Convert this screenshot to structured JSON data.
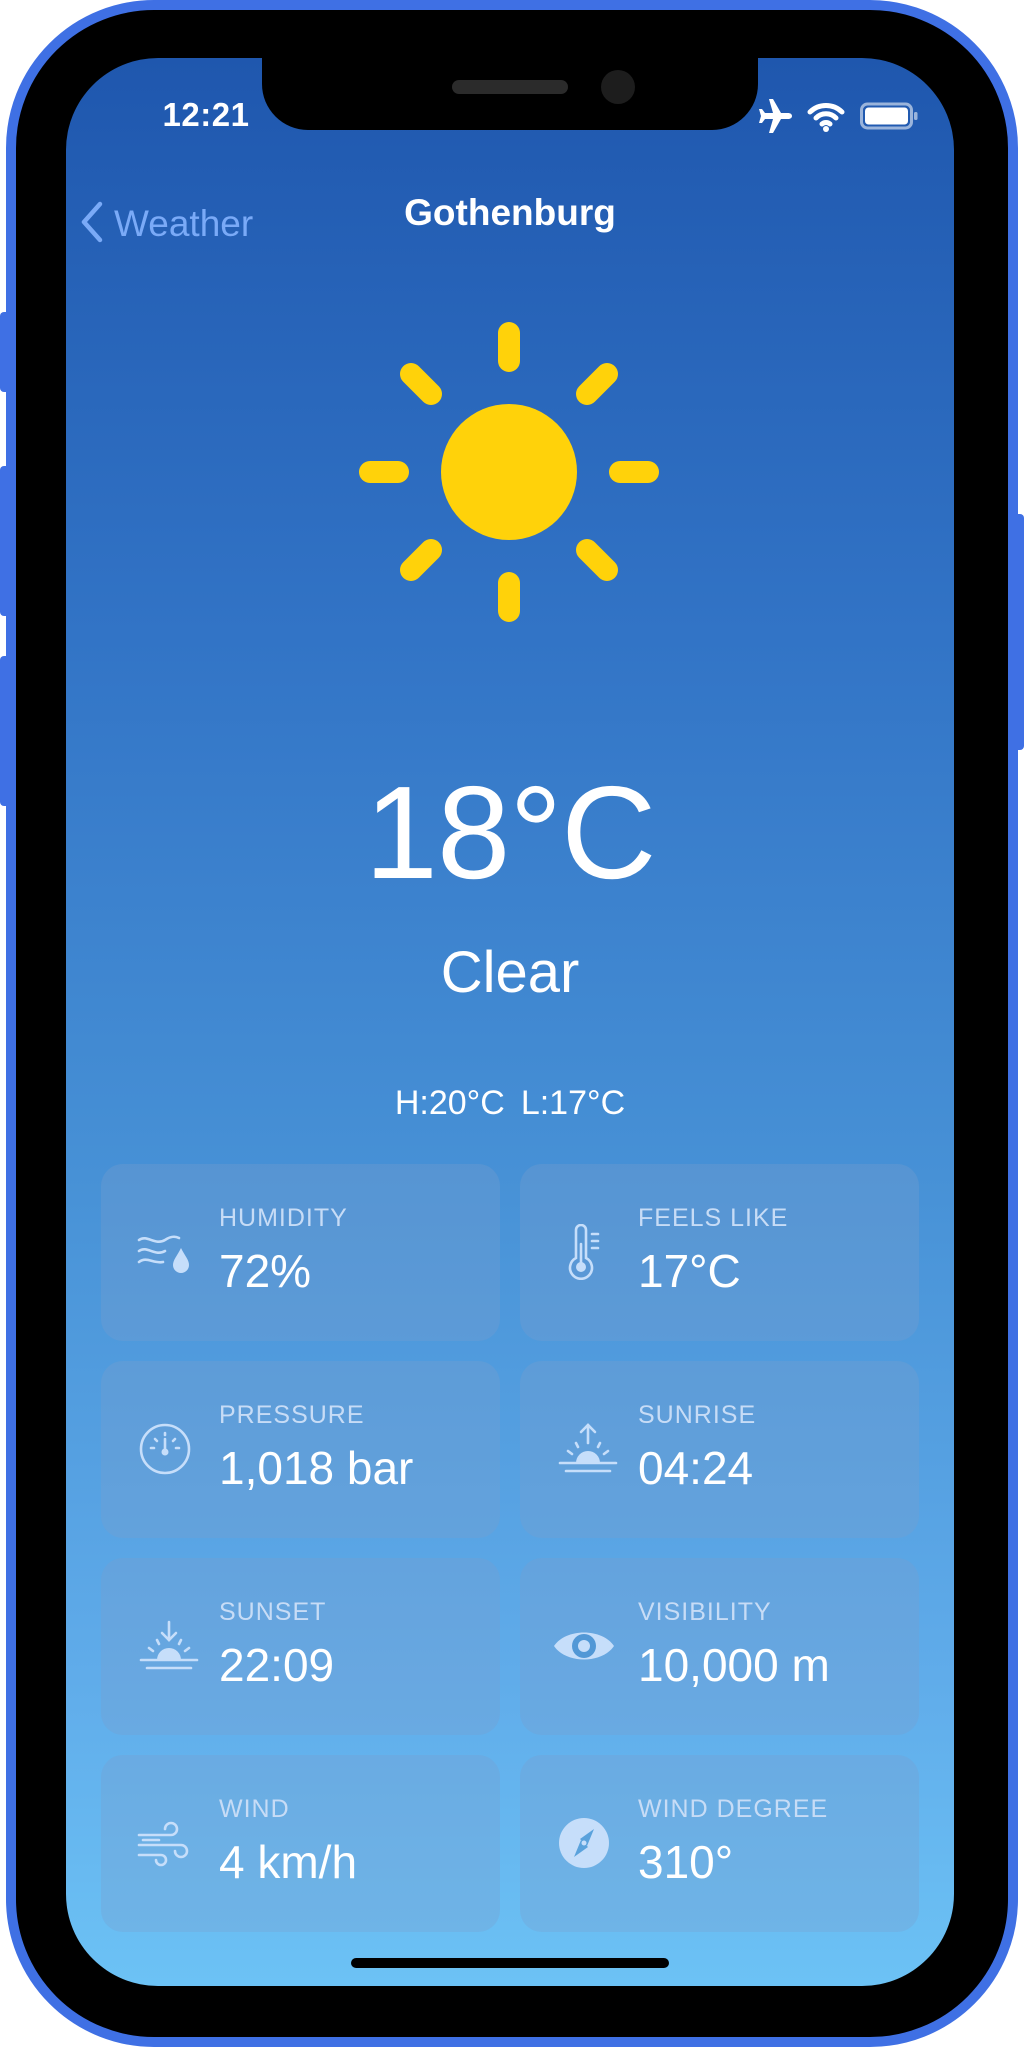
{
  "status_bar": {
    "time": "12:21",
    "icons": [
      "airplane-icon",
      "wifi-icon",
      "battery-icon"
    ]
  },
  "nav": {
    "back_label": "Weather",
    "title": "Gothenburg"
  },
  "current": {
    "icon": "sun-icon",
    "temperature": "18°C",
    "condition": "Clear",
    "high": "H:20°C",
    "low": "L:17°C"
  },
  "cards": [
    {
      "label": "HUMIDITY",
      "value": "72%",
      "icon": "humidity-icon"
    },
    {
      "label": "FEELS LIKE",
      "value": "17°C",
      "icon": "thermometer-icon"
    },
    {
      "label": "PRESSURE",
      "value": "1,018 bar",
      "icon": "gauge-icon"
    },
    {
      "label": "SUNRISE",
      "value": "04:24",
      "icon": "sunrise-icon"
    },
    {
      "label": "SUNSET",
      "value": "22:09",
      "icon": "sunset-icon"
    },
    {
      "label": "VISIBILITY",
      "value": "10,000 m",
      "icon": "eye-icon"
    },
    {
      "label": "WIND",
      "value": "4 km/h",
      "icon": "wind-icon"
    },
    {
      "label": "WIND DEGREE",
      "value": "310°",
      "icon": "compass-icon"
    }
  ],
  "colors": {
    "device_frame": "#3f70e4",
    "sun": "#ffd20a",
    "back_link": "#7aaaf7",
    "gradient_top": "#1f57ae",
    "gradient_bottom": "#6cc2f5"
  }
}
